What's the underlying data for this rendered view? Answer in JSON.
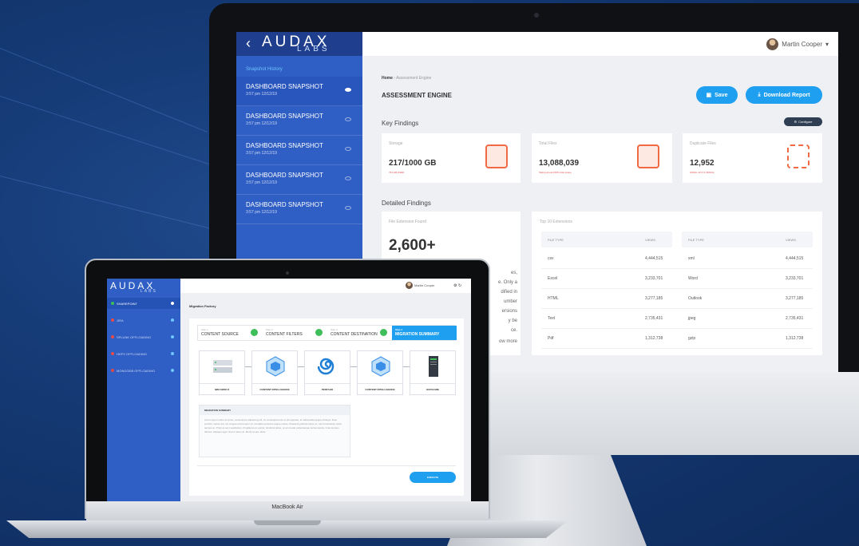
{
  "desktop": {
    "brand": {
      "name": "AUDAX",
      "sub": "LABS"
    },
    "sidebar": {
      "section_title": "Snapshot History",
      "items": [
        {
          "name": "DASHBOARD SNAPSHOT",
          "time": "3:57 pm 12/12/19"
        },
        {
          "name": "DASHBOARD SNAPSHOT",
          "time": "3:57 pm 12/12/19"
        },
        {
          "name": "DASHBOARD SNAPSHOT",
          "time": "3:57 pm 12/12/19"
        },
        {
          "name": "DASHBOARD SNAPSHOT",
          "time": "3:57 pm 12/12/19"
        },
        {
          "name": "DASHBOARD SNAPSHOT",
          "time": "3:57 pm 12/12/19"
        }
      ]
    },
    "header": {
      "user_name": "Martin Cooper"
    },
    "breadcrumb": {
      "home": "Home",
      "current": "Assessment Engine"
    },
    "page_title": "ASSESSMENT ENGINE",
    "buttons": {
      "save": "Save",
      "download": "Download Report",
      "configure": "Configure"
    },
    "key_findings": {
      "title": "Key Findings",
      "cards": [
        {
          "label": "Storage",
          "value": "217/1000 GB",
          "sub": "763 GB USED"
        },
        {
          "label": "Total Files",
          "value": "13,088,039",
          "sub": "Taking around 60% disk space"
        },
        {
          "label": "Duplicate Files",
          "value": "12,952",
          "sub": "USING 10.3 % SPACE"
        }
      ]
    },
    "detailed_findings": {
      "title": "Detailed Findings",
      "file_extension": {
        "label": "File Extension Found",
        "value": "2,600+",
        "text_lines": [
          "es,",
          "e. Only a",
          "dified in",
          "umber",
          "ersions",
          "y be",
          "ce.",
          "ow more"
        ]
      },
      "top10": {
        "title": "Top 10 Extensions",
        "columns": [
          "FILE TYPE",
          "VIEWS",
          "FILE TYPE",
          "VIEWS"
        ],
        "rows": [
          [
            "csv",
            "4,444,515",
            "xml",
            "4,444,515"
          ],
          [
            "Excel",
            "3,233,701",
            "Word",
            "3,233,701"
          ],
          [
            "HTML",
            "3,277,185",
            "Outlook",
            "3,277,185"
          ],
          [
            "Text",
            "2,735,431",
            "jpeg",
            "2,735,431"
          ],
          [
            "Pdf",
            "1,312,738",
            "gzip",
            "1,312,738"
          ]
        ]
      }
    }
  },
  "laptop": {
    "model_label": "MacBook Air",
    "brand": {
      "name": "AUDAX",
      "sub": "LABS"
    },
    "sidebar": {
      "items": [
        {
          "label": "SHAREPOINT",
          "dot_color": "#3fbf5a",
          "active": true
        },
        {
          "label": "JIRA",
          "dot_color": "#e84a4a"
        },
        {
          "label": "SPLUNK OFFLOADING",
          "dot_color": "#e84a4a"
        },
        {
          "label": "HDFS OFFLOADING",
          "dot_color": "#e84a4a"
        },
        {
          "label": "MONGODB OFFLOADING",
          "dot_color": "#e84a4a"
        }
      ]
    },
    "header": {
      "user_name": "Martin Cooper"
    },
    "page_title": "Migration Factory",
    "steps": [
      {
        "num": "Step 1",
        "name": "CONTENT SOURCE",
        "done": true
      },
      {
        "num": "Step 2",
        "name": "CONTENT FILTERS",
        "done": true
      },
      {
        "num": "Step 3",
        "name": "CONTENT DESTINATION",
        "done": true
      },
      {
        "num": "Step 4",
        "name": "MIGRATION SUMMARY",
        "active": true
      }
    ],
    "flow": [
      {
        "caption": "IBM CMOD 8",
        "icon": "server-rack-icon"
      },
      {
        "caption": "CONTENT INTELLIGENCE",
        "icon": "cube-icon"
      },
      {
        "caption": "PENTAHO",
        "icon": "swirl-icon"
      },
      {
        "caption": "CONTENT INTELLIGENCE",
        "icon": "cube-icon"
      },
      {
        "caption": "HCP/ACME",
        "icon": "tower-server-icon"
      }
    ],
    "summary": {
      "title": "MIGRATION SUMMARY",
      "body": "Lorem ipsum dolor sit amet, consectetur adipiscing elit. Ut consequat enim in elit egestas, at malesuada augue tristique. Duis porttitor metus nisi, vel congue erat tempor sit. Curabitur posuere augue metus. Praesent pulvinar lacus ex, sed consectetur tortor tempus et. Proin at sem vestibulum, fringilla lorem auctor, tincidunt tellus, ut commodo pellentesque lectus iaculis. Cras tempus ultrices. Aliquam eget. Sed ut lacus at. Morbi at sem dolor."
    },
    "execute": "EXECUTE"
  },
  "colors": {
    "sidebar_blue": "#2f5ec4",
    "accent": "#1f9ff0",
    "success": "#3fbf5a",
    "alert": "#e84a4a",
    "icon_orange": "#ef6a44"
  }
}
